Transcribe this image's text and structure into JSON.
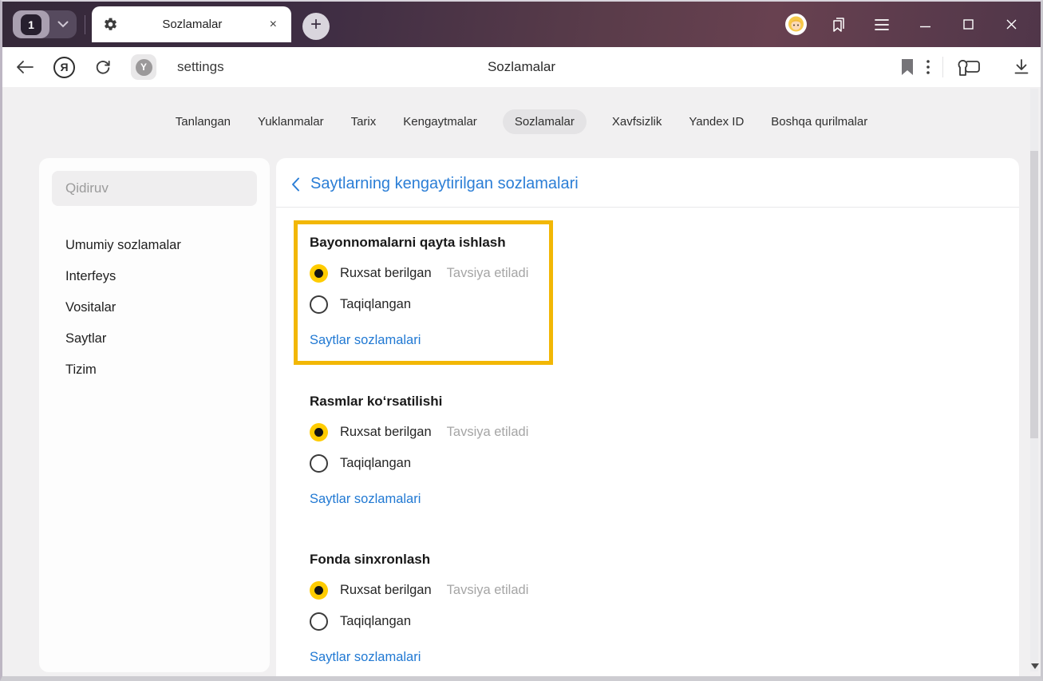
{
  "titlebar": {
    "tab_count": "1",
    "tab_title": "Sozlamalar",
    "close_tab_glyph": "×",
    "new_tab_glyph": "+"
  },
  "address_bar": {
    "yandex_logo_glyph": "Я",
    "protect_badge_glyph": "Y",
    "url": "settings",
    "page_title": "Sozlamalar"
  },
  "nav_tabs": {
    "items": [
      {
        "label": "Tanlangan",
        "active": false
      },
      {
        "label": "Yuklanmalar",
        "active": false
      },
      {
        "label": "Tarix",
        "active": false
      },
      {
        "label": "Kengaytmalar",
        "active": false
      },
      {
        "label": "Sozlamalar",
        "active": true
      },
      {
        "label": "Xavfsizlik",
        "active": false
      },
      {
        "label": "Yandex ID",
        "active": false
      },
      {
        "label": "Boshqa qurilmalar",
        "active": false
      }
    ]
  },
  "sidebar": {
    "search_placeholder": "Qidiruv",
    "items": [
      {
        "label": "Umumiy sozlamalar"
      },
      {
        "label": "Interfeys"
      },
      {
        "label": "Vositalar"
      },
      {
        "label": "Saytlar"
      },
      {
        "label": "Tizim"
      }
    ]
  },
  "main": {
    "heading": "Saytlarning kengaytirilgan sozlamalari",
    "sections": [
      {
        "title": "Bayonnomalarni qayta ishlash",
        "highlighted": true,
        "options": [
          {
            "label": "Ruxsat berilgan",
            "note": "Tavsiya etiladi",
            "selected": true
          },
          {
            "label": "Taqiqlangan",
            "selected": false
          }
        ],
        "link": "Saytlar sozlamalari"
      },
      {
        "title": "Rasmlar koʻrsatilishi",
        "highlighted": false,
        "options": [
          {
            "label": "Ruxsat berilgan",
            "note": "Tavsiya etiladi",
            "selected": true
          },
          {
            "label": "Taqiqlangan",
            "selected": false
          }
        ],
        "link": "Saytlar sozlamalari"
      },
      {
        "title": "Fonda sinxronlash",
        "highlighted": false,
        "options": [
          {
            "label": "Ruxsat berilgan",
            "note": "Tavsiya etiladi",
            "selected": true
          },
          {
            "label": "Taqiqlangan",
            "selected": false
          }
        ],
        "link": "Saytlar sozlamalari"
      }
    ]
  },
  "colors": {
    "highlight_border": "#f2b705",
    "radio_accent_yellow": "#ffcc00",
    "link_blue": "#2179d3",
    "heading_blue": "#2b7ed6",
    "titlebar_gradient_start": "#352939",
    "titlebar_gradient_end": "#503649"
  }
}
